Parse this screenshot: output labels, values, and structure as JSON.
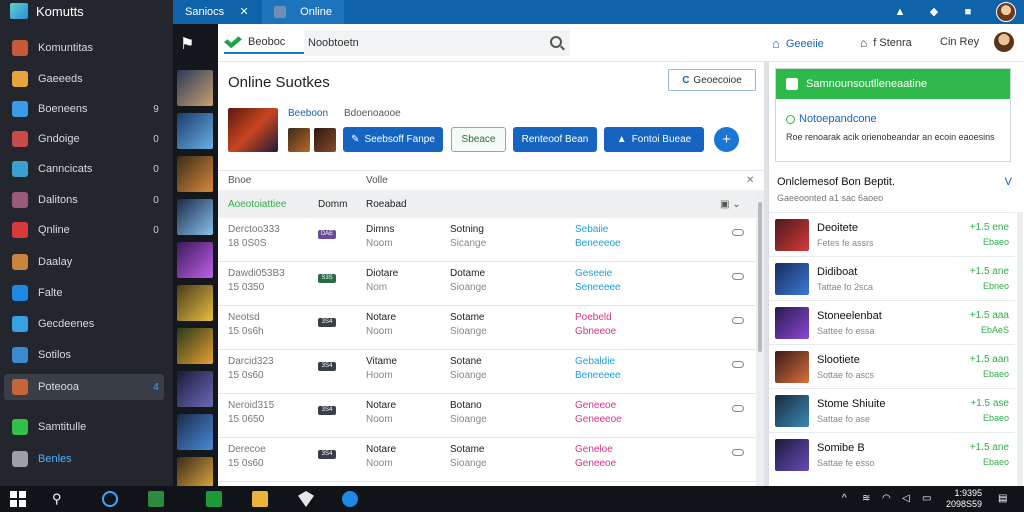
{
  "sidebar": {
    "title": "Komutts",
    "items": [
      {
        "label": "Komuntitas",
        "count": "",
        "color": "#c85a3a"
      },
      {
        "label": "Gaeeeds",
        "count": "",
        "color": "#e8a43a"
      },
      {
        "label": "Boeneens",
        "count": "9",
        "color": "#3a9ae8"
      },
      {
        "label": "Gndoige",
        "count": "0",
        "color": "#c84a4a"
      },
      {
        "label": "Canncicats",
        "count": "0",
        "color": "#3aa0d0"
      },
      {
        "label": "Dalitons",
        "count": "0",
        "color": "#9a5a7a"
      },
      {
        "label": "Qnline",
        "count": "0",
        "color": "#d83a3a"
      },
      {
        "label": "Daalay",
        "count": "",
        "color": "#c8843a"
      },
      {
        "label": "Falte",
        "count": "",
        "color": "#1e88e5"
      },
      {
        "label": "Gecdeenes",
        "count": "",
        "color": "#3aa0e8"
      },
      {
        "label": "Sotilos",
        "count": "",
        "color": "#3a8ad0"
      },
      {
        "label": "Poteooa",
        "count": "4",
        "color": "#c8643a"
      },
      {
        "label": "Samtitulle",
        "count": "",
        "color": "#2fbf4a"
      },
      {
        "label": "Benles",
        "count": "",
        "color": "#9aa0a6"
      }
    ]
  },
  "topbar": {
    "tabs": [
      {
        "label": "Saniocs"
      },
      {
        "label": "Online"
      }
    ]
  },
  "header": {
    "logo_label": "Beoboc",
    "search_value": "Noobtoetn",
    "link1": "Geeeiie",
    "link2": "f Stenra",
    "link3": "Cin Rey"
  },
  "main": {
    "title": "Online Suotkes",
    "top_action": "Geoecoioe",
    "selected_title": "Beeboon",
    "selected_sub": "Bdoenoaooe",
    "buttons": [
      "Seebsoff Fanpe",
      "Sbeace",
      "Renteoof Bean",
      "Fontoi Bueae"
    ],
    "table_header": {
      "left": "Bnoe",
      "right": "Volle"
    },
    "columns": [
      "Aoeotoiattiee",
      "Domm",
      "Roeabad"
    ],
    "rows": [
      {
        "line1": "Derctoo333",
        "line2": "18 0S0S",
        "tag": "DAE",
        "tagcolor": "#6a4a9a",
        "name1": "Dimns",
        "name2": "Noom",
        "cat1": "Sotning",
        "cat2": "Sicange",
        "st1": "Sebaiie",
        "st2": "Beneeeoe",
        "stcolor": "#1e9fd8"
      },
      {
        "line1": "Dawdi053B3",
        "line2": "15 0350",
        "tag": "S3S",
        "tagcolor": "#2a6a4a",
        "name1": "Diotare",
        "name2": "Nom",
        "cat1": "Dotame",
        "cat2": "Sioange",
        "st1": "Geseeie",
        "st2": "Seneeeee",
        "stcolor": "#1e9fd8"
      },
      {
        "line1": "Neotsd",
        "line2": "15 0s6h",
        "tag": "3S4",
        "tagcolor": "#3a3f47",
        "name1": "Notare",
        "name2": "Noom",
        "cat1": "Sotame",
        "cat2": "Sioange",
        "st1": "Poebeld",
        "st2": "Gbneeoe",
        "stcolor": "#d6338a"
      },
      {
        "line1": "Darcid323",
        "line2": "15 0s60",
        "tag": "3S4",
        "tagcolor": "#3a3f47",
        "name1": "Vitame",
        "name2": "Hoom",
        "cat1": "Sotane",
        "cat2": "Sioange",
        "st1": "Gebaldie",
        "st2": "Beneeeee",
        "stcolor": "#1e9fd8"
      },
      {
        "line1": "Neroid315",
        "line2": "15 0650",
        "tag": "3S4",
        "tagcolor": "#3a3f47",
        "name1": "Notare",
        "name2": "Noom",
        "cat1": "Botano",
        "cat2": "Sioange",
        "st1": "Geneeoe",
        "st2": "Geneeeoe",
        "stcolor": "#d6338a"
      },
      {
        "line1": "Derecoe",
        "line2": "15 0s60",
        "tag": "3S4",
        "tagcolor": "#3a3f47",
        "name1": "Notare",
        "name2": "Noom",
        "cat1": "Sotame",
        "cat2": "Sioange",
        "st1": "Geneloe",
        "st2": "Geneeoe",
        "stcolor": "#d6338a"
      }
    ]
  },
  "notification": {
    "title": "Samnounsoutlleneaatine",
    "subtitle": "Notoepandcone",
    "body": "Roe renoarak acik orienobeandar an ecoin eaoesins"
  },
  "rightlist": {
    "title": "Onlclemesof Bon Beptit.",
    "subtitle": "Gaeeoonted a1 sac 6aoeo",
    "toggle": "V",
    "items": [
      {
        "name": "Deoitete",
        "sub": "Fetes fe assrs",
        "v1": "+1.5 ene",
        "v2": "Ebaeo"
      },
      {
        "name": "Didiboat",
        "sub": "Tattae fo 2sca",
        "v1": "+1.5 ane",
        "v2": "Ebneo"
      },
      {
        "name": "Stoneelenbat",
        "sub": "Sattee fo essa",
        "v1": "+1.5 aaa",
        "v2": "EbAeS"
      },
      {
        "name": "Slootiete",
        "sub": "Sottae fo ascs",
        "v1": "+1.5 aan",
        "v2": "Ebaeo"
      },
      {
        "name": "Stome Shiuite",
        "sub": "Sattae fo ase",
        "v1": "+1.5 ase",
        "v2": "Ebaeo"
      },
      {
        "name": "Somibe B",
        "sub": "Sattae fe esso",
        "v1": "+1.5 ane",
        "v2": "Ebaeo"
      }
    ]
  },
  "taskbar": {
    "time": "1:9395",
    "date": "2098S59"
  },
  "colors": {
    "accent": "#0f63a8",
    "green": "#2fb94a",
    "sidebar": "#23272d"
  }
}
